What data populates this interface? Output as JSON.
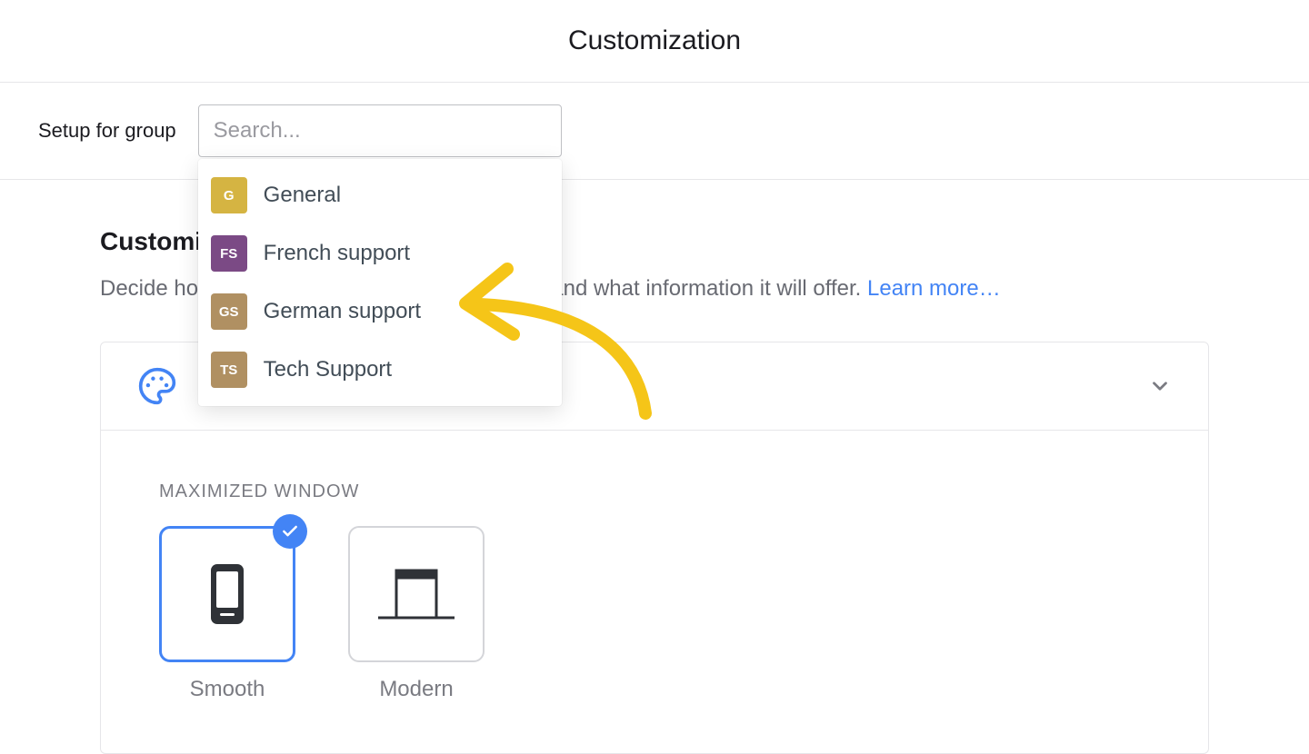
{
  "header": {
    "title": "Customization"
  },
  "subheader": {
    "label": "Setup for group",
    "search_placeholder": "Search..."
  },
  "dropdown": {
    "items": [
      {
        "initials": "G",
        "label": "General",
        "bg": "#d5b442"
      },
      {
        "initials": "FS",
        "label": "French support",
        "bg": "#7b4a85"
      },
      {
        "initials": "GS",
        "label": "German support",
        "bg": "#b09062"
      },
      {
        "initials": "TS",
        "label": "Tech Support",
        "bg": "#b09062"
      }
    ]
  },
  "content": {
    "section_title": "Customization",
    "section_desc_prefix": "Decide how your chat widget will look, behave and what information it will offer. ",
    "learn_more": "Learn more…"
  },
  "panel": {
    "title": "Appearance",
    "maximized_label": "MAXIMIZED WINDOW",
    "options": [
      {
        "label": "Smooth",
        "selected": true
      },
      {
        "label": "Modern",
        "selected": false
      }
    ]
  }
}
